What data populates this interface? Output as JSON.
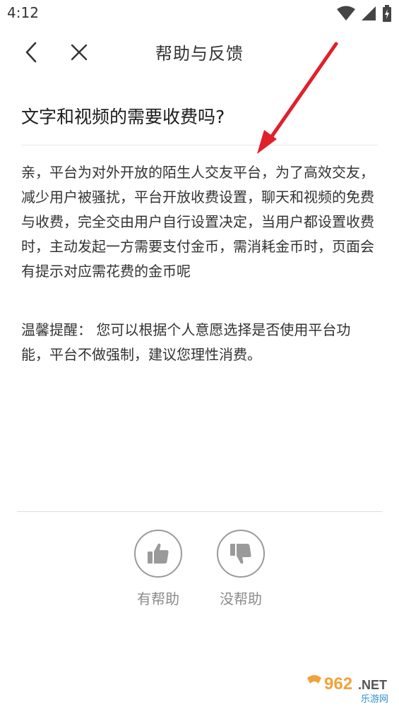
{
  "status_bar": {
    "time": "4:12"
  },
  "header": {
    "title": "帮助与反馈"
  },
  "question": {
    "title": "文字和视频的需要收费吗?"
  },
  "answer": {
    "text": "亲，平台为对外开放的陌生人交友平台，为了高效交友，减少用户被骚扰，平台开放收费设置，聊天和视频的免费与收费，完全交由用户自行设置决定，当用户都设置收费时，主动发起一方需要支付金币，需消耗金币时，页面会有提示对应需花费的金币呢"
  },
  "reminder": {
    "text": "温馨提醒： 您可以根据个人意愿选择是否使用平台功能，平台不做强制，建议您理性消费。"
  },
  "feedback": {
    "helpful_label": "有帮助",
    "not_helpful_label": "没帮助"
  },
  "watermark": {
    "brand": "962",
    "suffix": ".NET",
    "tagline": "乐游网"
  },
  "colors": {
    "arrow": "#e0202a",
    "icon_gray": "#9a9a9a",
    "label_gray": "#8c8c8c"
  }
}
